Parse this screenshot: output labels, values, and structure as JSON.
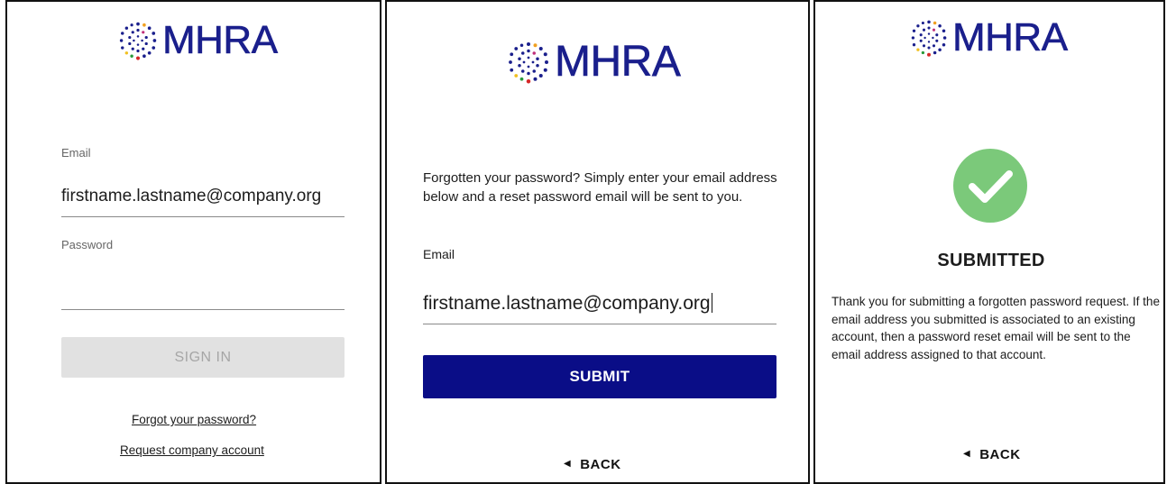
{
  "brand": {
    "logo_text": "MHRA",
    "brand_color": "#1a1f8c"
  },
  "panel_login": {
    "email_label": "Email",
    "email_value": "firstname.lastname@company.org",
    "password_label": "Password",
    "password_value": "",
    "sign_in_label": "SIGN IN",
    "forgot_link": "Forgot your password?",
    "request_link": "Request company account"
  },
  "panel_forgot": {
    "intro_text": "Forgotten your password? Simply enter your email address below and a reset password email will be sent to you.",
    "email_label": "Email",
    "email_value": "firstname.lastname@company.org",
    "submit_label": "SUBMIT",
    "back_label": "BACK",
    "back_icon": "caret-left-icon",
    "submit_color": "#0a0d87"
  },
  "panel_submitted": {
    "success_icon": "check-circle-icon",
    "success_color": "#7bc97a",
    "heading": "SUBMITTED",
    "message": "Thank you for submitting a forgotten password request. If the email address you submitted is associated to an existing account, then a password reset email will be sent to the email address assigned to that account.",
    "back_label": "BACK",
    "back_icon": "caret-left-icon"
  }
}
